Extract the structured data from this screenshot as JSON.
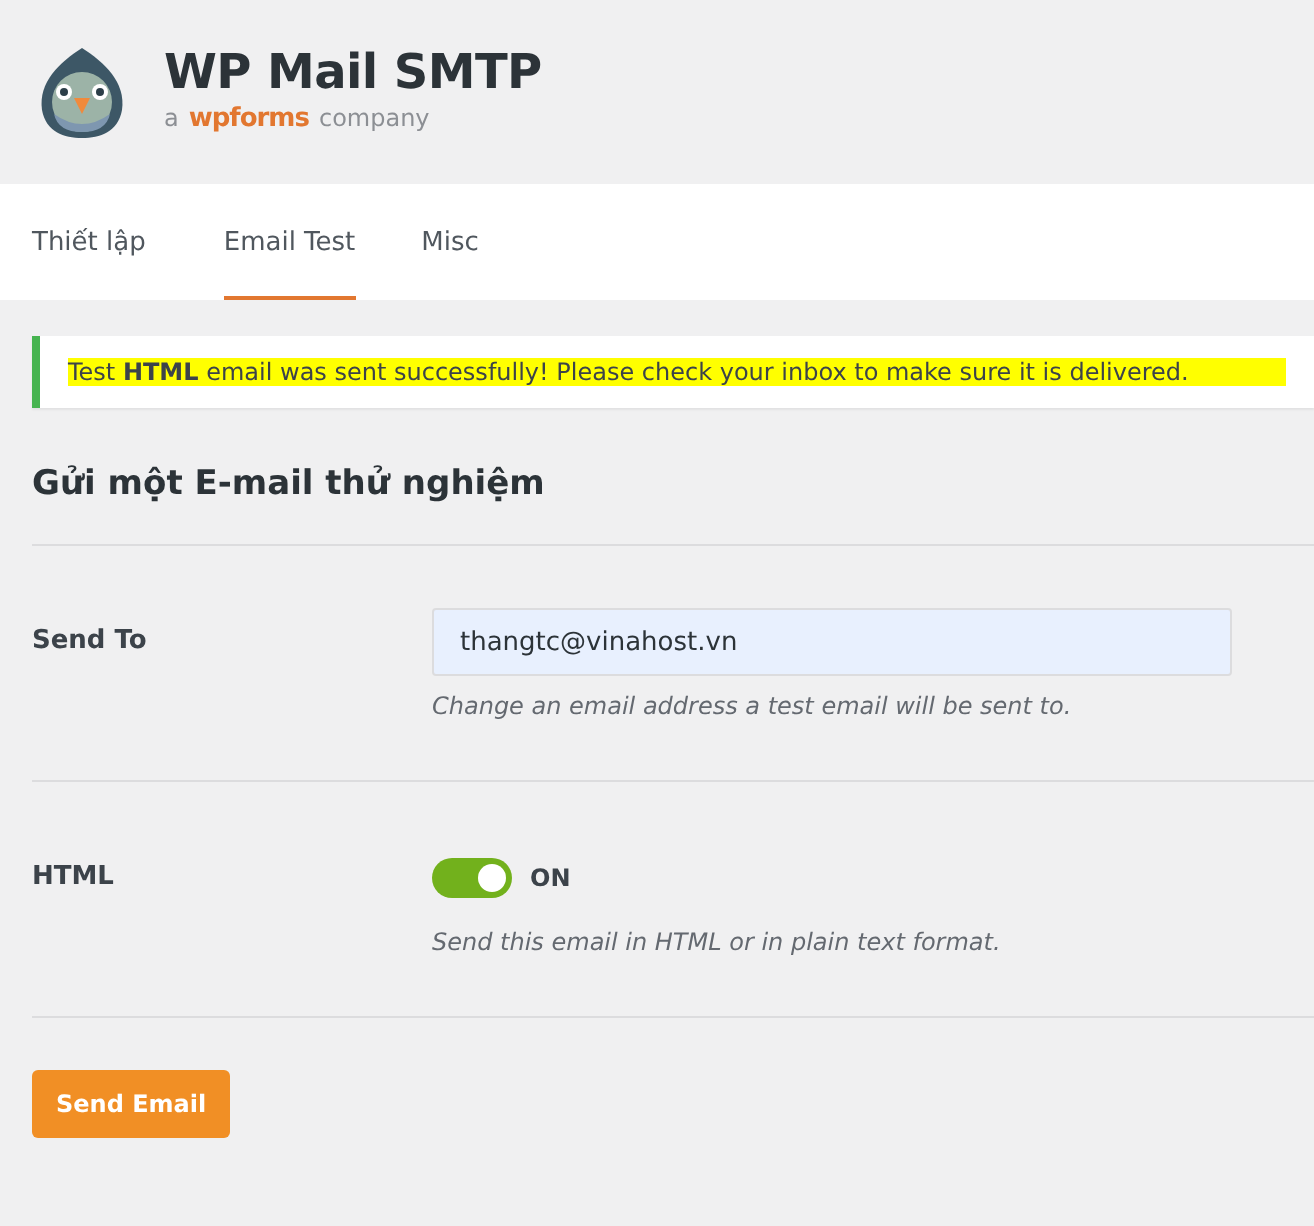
{
  "header": {
    "title": "WP Mail SMTP",
    "tagline_prefix": "a",
    "tagline_brand": "wpforms",
    "tagline_suffix": "company"
  },
  "tabs": [
    {
      "label": "Thiết lập",
      "selected": false
    },
    {
      "label": "Email Test",
      "selected": true
    },
    {
      "label": "Misc",
      "selected": false
    }
  ],
  "notice": {
    "text": "Test **HTML** email was sent successfully! Please check your inbox to make sure it is delivered.",
    "highlighted": true
  },
  "section_title": "Gửi một E-mail thử nghiệm",
  "fields": [
    {
      "kind": "input",
      "label": "Send To",
      "value": "thangtc@vinahost.vn",
      "description": "Change an email address a test email will be sent to."
    },
    {
      "kind": "toggle",
      "label": "HTML",
      "on": true,
      "state_label": "ON",
      "description": "Send this email in HTML or in plain text format."
    }
  ],
  "button": "Send Email"
}
